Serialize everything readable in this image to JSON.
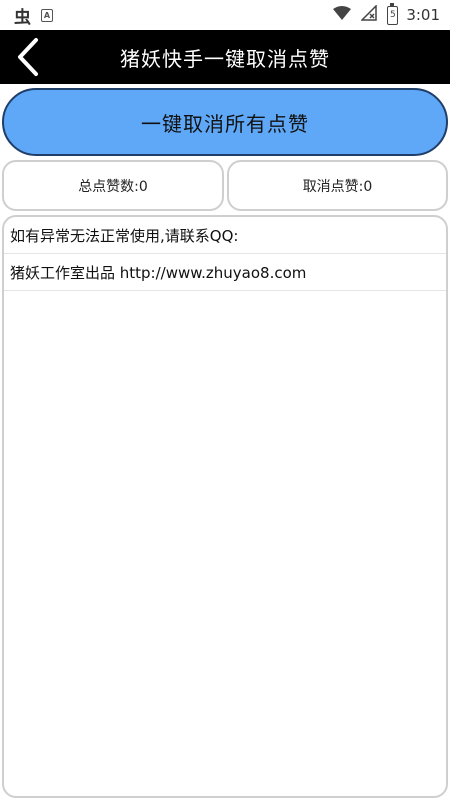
{
  "status_bar": {
    "app_icon": "虫",
    "notification_icon": "A",
    "battery_label": "5",
    "time": "3:01"
  },
  "title_bar": {
    "title": "猪妖快手一键取消点赞"
  },
  "main": {
    "cancel_all_button": "一键取消所有点赞",
    "total_likes": "总点赞数:0",
    "cancelled_likes": "取消点赞:0",
    "log_lines": [
      "如有异常无法正常使用,请联系QQ:",
      "猪妖工作室出品 http://www.zhuyao8.com"
    ]
  },
  "colors": {
    "title_bar_bg": "#000000",
    "primary_button_bg": "#5ea8f7",
    "primary_button_border": "#1f3f6a",
    "box_border": "#cfcfcf"
  }
}
